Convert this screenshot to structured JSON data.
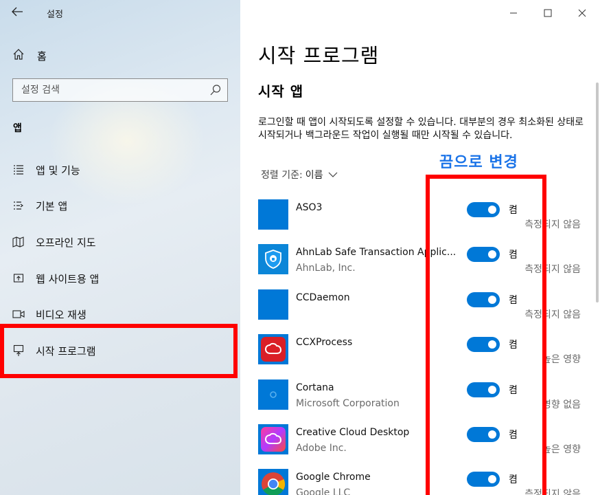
{
  "window": {
    "title": "설정"
  },
  "sidebar": {
    "home_label": "홈",
    "search_placeholder": "설정 검색",
    "section": "앱",
    "items": [
      {
        "label": "앱 및 기능",
        "icon": "list-icon"
      },
      {
        "label": "기본 앱",
        "icon": "default-apps-icon"
      },
      {
        "label": "오프라인 지도",
        "icon": "map-icon"
      },
      {
        "label": "웹 사이트용 앱",
        "icon": "web-app-icon"
      },
      {
        "label": "비디오 재생",
        "icon": "video-icon"
      },
      {
        "label": "시작 프로그램",
        "icon": "startup-icon",
        "selected": true
      }
    ]
  },
  "main": {
    "title": "시작 프로그램",
    "subtitle": "시작 앱",
    "description": "로그인할 때 앱이 시작되도록 설정할 수 있습니다. 대부분의 경우 최소화된 상태로 시작되거나 백그라운드 작업이 실행될 때만 시작될 수 있습니다.",
    "sort_label": "정렬 기준:",
    "sort_value": "이름",
    "annotation": "끔으로 변경",
    "apps": [
      {
        "name": "ASO3",
        "publisher": "",
        "state": "켬",
        "on": true,
        "impact": "측정되지 않음",
        "icon": "blank-tile-icon"
      },
      {
        "name": "AhnLab Safe Transaction Applic...",
        "publisher": "AhnLab, Inc.",
        "state": "켬",
        "on": true,
        "impact": "측정되지 않음",
        "icon": "shield-icon"
      },
      {
        "name": "CCDaemon",
        "publisher": "",
        "state": "켬",
        "on": true,
        "impact": "측정되지 않음",
        "icon": "blank-tile-icon"
      },
      {
        "name": "CCXProcess",
        "publisher": "",
        "state": "켬",
        "on": true,
        "impact": "높은 영향",
        "icon": "creative-cloud-red-icon"
      },
      {
        "name": "Cortana",
        "publisher": "Microsoft Corporation",
        "state": "켬",
        "on": true,
        "impact": "영향 없음",
        "icon": "cortana-icon"
      },
      {
        "name": "Creative Cloud Desktop",
        "publisher": "Adobe Inc.",
        "state": "켬",
        "on": true,
        "impact": "높은 영향",
        "icon": "creative-cloud-icon"
      },
      {
        "name": "Google Chrome",
        "publisher": "Google LLC",
        "state": "켬",
        "on": true,
        "impact": "측정되지 않음",
        "icon": "chrome-icon"
      }
    ]
  },
  "colors": {
    "accent": "#0078d7",
    "highlight": "#ff0000",
    "annotation": "#1a73e8"
  }
}
